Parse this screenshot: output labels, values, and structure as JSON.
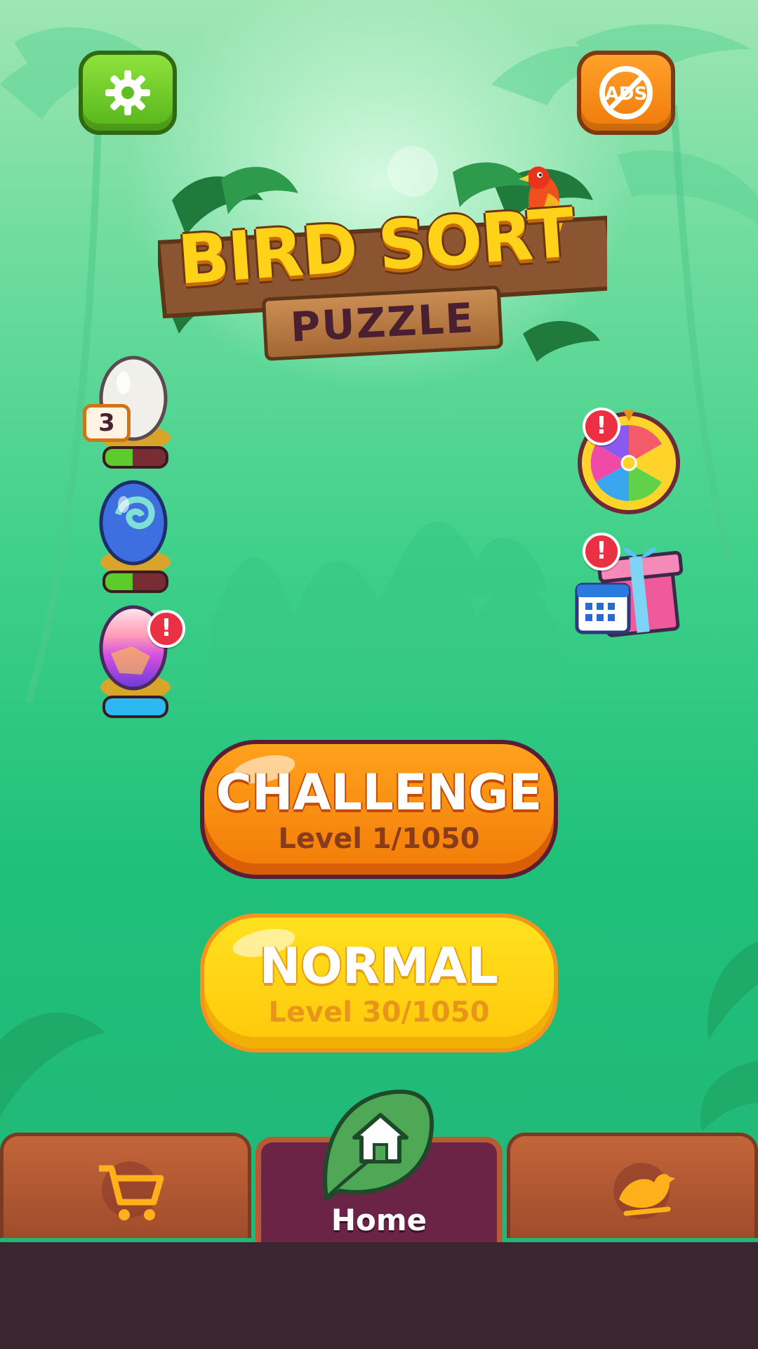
{
  "app": {
    "logo_line1": "BIRD SORT",
    "logo_line2": "PUZZLE"
  },
  "top_buttons": {
    "settings_icon": "gear-icon",
    "noads_label": "ADS"
  },
  "eggs": [
    {
      "type": "white",
      "badge": "3",
      "progress": 0.45,
      "color": "#f2efe8"
    },
    {
      "type": "blue",
      "progress": 0.45,
      "color": "#3d6fe0"
    },
    {
      "type": "rainbow",
      "progress": 1.0,
      "alert": "!",
      "color": "#c04fe0"
    }
  ],
  "side_buttons": [
    {
      "name": "spin-wheel",
      "alert": "!"
    },
    {
      "name": "daily-gift",
      "alert": "!"
    }
  ],
  "modes": {
    "challenge": {
      "title": "CHALLENGE",
      "level": "Level 1/1050"
    },
    "normal": {
      "title": "NORMAL",
      "level": "Level 30/1050"
    }
  },
  "tabbar": {
    "home_label": "Home",
    "tabs": [
      "shop",
      "home",
      "birds"
    ]
  },
  "colors": {
    "accent_orange": "#f27b08",
    "accent_yellow": "#ffc80a",
    "tab_active": "#6b2346"
  }
}
